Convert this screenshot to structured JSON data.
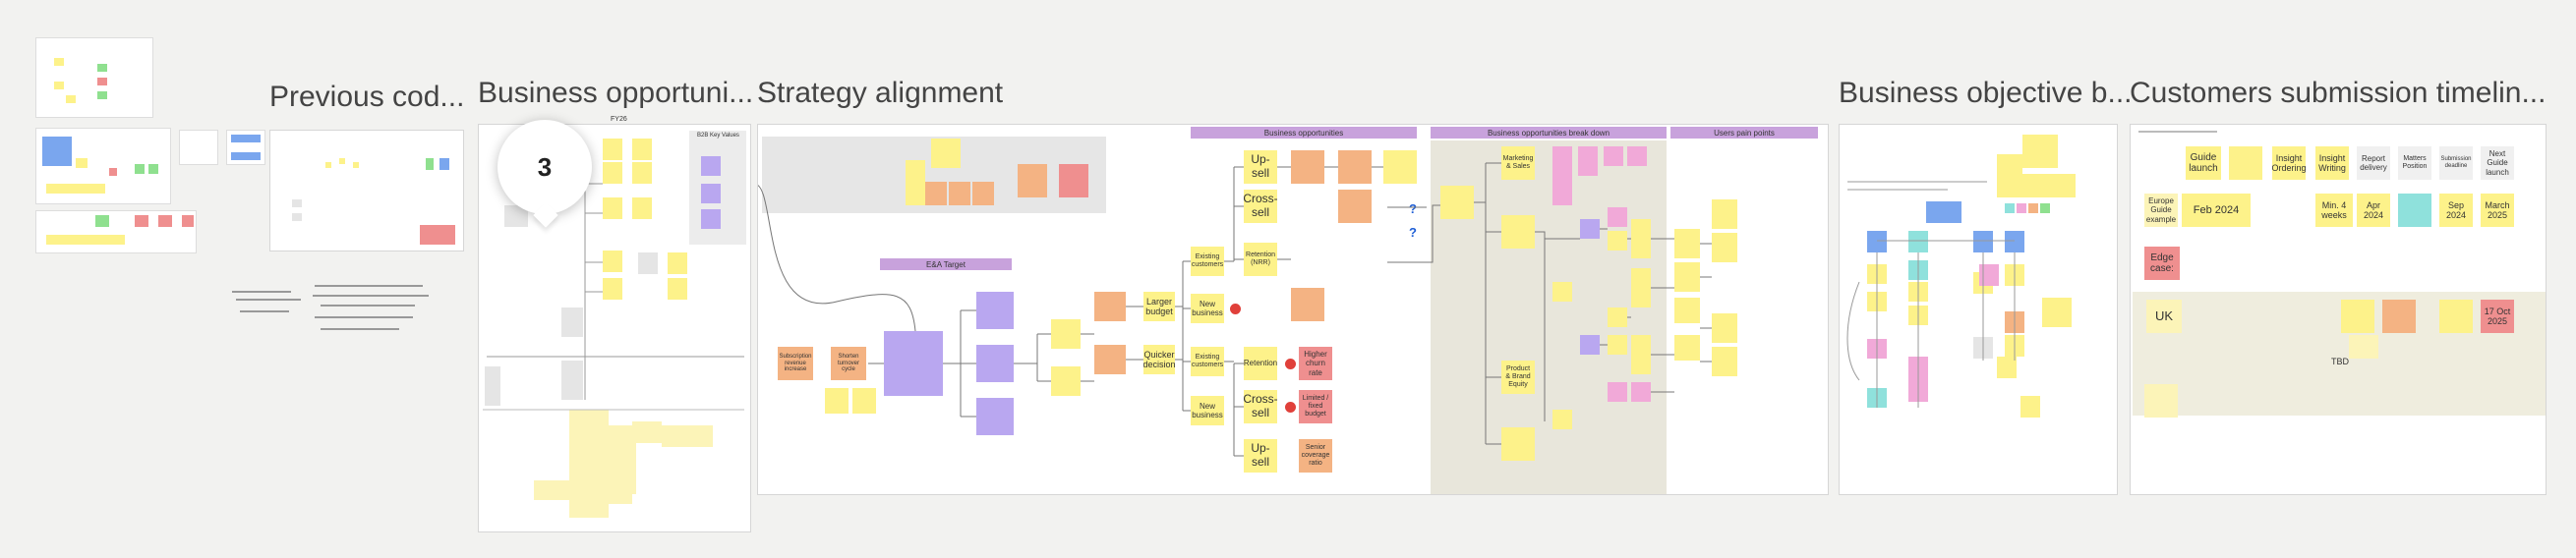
{
  "frames": {
    "previous": "Previous cod...",
    "business_opportunities": "Business opportuni...",
    "strategy": "Strategy alignment",
    "objective": "Business objective b...",
    "timeline": "Customers submission timelin..."
  },
  "comment_badge": "3",
  "biz_frame": {
    "header_small": "FY26",
    "key_values": "B2B Key Values"
  },
  "strategy_frame": {
    "ea_target": "E&A Target",
    "header_opportunities": "Business opportunities",
    "header_breakdown": "Business opportunities break down",
    "header_pain": "Users pain points",
    "notes": {
      "subscription": "Subscription revenue increase",
      "shorten": "Shorten turnover cycle",
      "larger_budget": "Larger budget",
      "quicker_decision": "Quicker decision",
      "existing_customers": "Existing customers",
      "new_business_1": "New business",
      "new_business_2": "New business",
      "existing_2": "Existing customers",
      "upsell_1": "Up-sell",
      "crosssell_1": "Cross-sell",
      "retention_1": "Retention (NRR)",
      "retention_2": "Retention",
      "crosssell_2": "Cross-sell",
      "upsell_2": "Up-sell",
      "higher_churn": "Higher churn rate",
      "limited_budget": "Limited / fixed budget",
      "senior": "Senior coverage ratio",
      "marketing": "Marketing & Sales",
      "product": "Product & Brand Equity"
    }
  },
  "timeline_frame": {
    "guide_launch": "Guide launch",
    "insight_ordering": "Insight Ordering",
    "insight_writing": "Insight Writing",
    "report_delivery": "Report delivery",
    "matters_position": "Matters Position",
    "submission_deadline": "Submission deadline",
    "next_guide_launch": "Next Guide launch",
    "europe_guide": "Europe Guide example",
    "feb_2024": "Feb 2024",
    "min_4_weeks": "Min. 4 weeks",
    "apr_2024": "Apr 2024",
    "sep_2024": "Sep 2024",
    "march_2025": "March 2025",
    "edge_case": "Edge case:",
    "uk": "UK",
    "tbd": "TBD",
    "oct_2025": "17 Oct 2025"
  },
  "colors": {
    "yellow": "#fdf28a",
    "orange": "#f4b383",
    "purple": "#b9a7f0",
    "pink": "#f1a9d8",
    "red": "#ef8f8f",
    "teal": "#8fe1dc",
    "blue": "#7aa6ee",
    "canvas": "#f2f2f0"
  }
}
